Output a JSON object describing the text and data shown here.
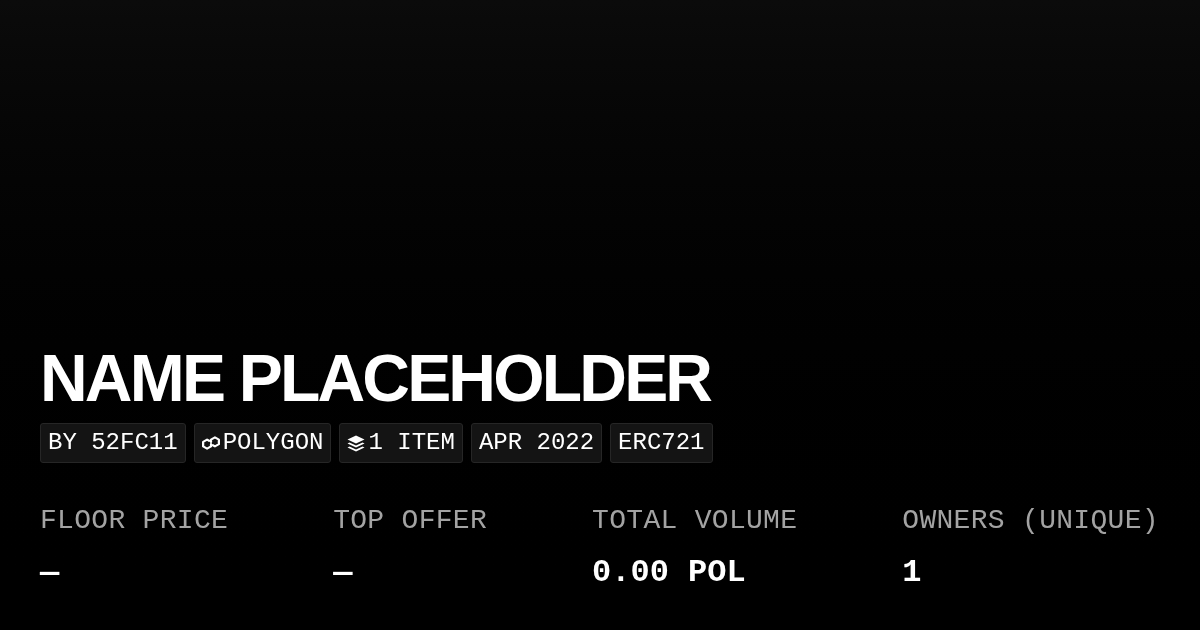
{
  "collection": {
    "title": "NAME PLACEHOLDER",
    "tags": [
      {
        "kind": "text",
        "label": "BY 52FC11"
      },
      {
        "kind": "chain",
        "label": "POLYGON"
      },
      {
        "kind": "items",
        "label": "1 ITEM"
      },
      {
        "kind": "text",
        "label": "APR 2022"
      },
      {
        "kind": "text",
        "label": "ERC721"
      }
    ]
  },
  "stats": [
    {
      "label": "FLOOR PRICE",
      "value": "—"
    },
    {
      "label": "TOP OFFER",
      "value": "—"
    },
    {
      "label": "TOTAL VOLUME",
      "value": "0.00 POL"
    },
    {
      "label": "OWNERS (UNIQUE)",
      "value": "1"
    }
  ]
}
